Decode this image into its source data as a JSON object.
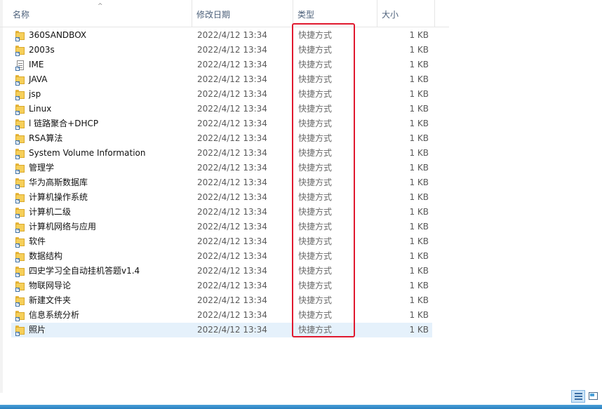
{
  "columns": {
    "name": "名称",
    "date": "修改日期",
    "type": "类型",
    "size": "大小"
  },
  "files": [
    {
      "name": "360SANDBOX",
      "date": "2022/4/12 13:34",
      "type": "快捷方式",
      "size": "1 KB",
      "icon": "folder-shortcut-icon"
    },
    {
      "name": "2003s",
      "date": "2022/4/12 13:34",
      "type": "快捷方式",
      "size": "1 KB",
      "icon": "folder-shortcut-icon"
    },
    {
      "name": "IME",
      "date": "2022/4/12 13:34",
      "type": "快捷方式",
      "size": "1 KB",
      "icon": "document-shortcut-icon"
    },
    {
      "name": "JAVA",
      "date": "2022/4/12 13:34",
      "type": "快捷方式",
      "size": "1 KB",
      "icon": "folder-shortcut-icon"
    },
    {
      "name": "jsp",
      "date": "2022/4/12 13:34",
      "type": "快捷方式",
      "size": "1 KB",
      "icon": "folder-shortcut-icon"
    },
    {
      "name": "Linux",
      "date": "2022/4/12 13:34",
      "type": "快捷方式",
      "size": "1 KB",
      "icon": "folder-shortcut-icon"
    },
    {
      "name": "l 链路聚合+DHCP",
      "date": "2022/4/12 13:34",
      "type": "快捷方式",
      "size": "1 KB",
      "icon": "folder-shortcut-icon"
    },
    {
      "name": "RSA算法",
      "date": "2022/4/12 13:34",
      "type": "快捷方式",
      "size": "1 KB",
      "icon": "folder-shortcut-icon"
    },
    {
      "name": "System Volume Information",
      "date": "2022/4/12 13:34",
      "type": "快捷方式",
      "size": "1 KB",
      "icon": "folder-shortcut-icon"
    },
    {
      "name": "管理学",
      "date": "2022/4/12 13:34",
      "type": "快捷方式",
      "size": "1 KB",
      "icon": "folder-shortcut-icon"
    },
    {
      "name": "华为高斯数据库",
      "date": "2022/4/12 13:34",
      "type": "快捷方式",
      "size": "1 KB",
      "icon": "folder-shortcut-icon"
    },
    {
      "name": "计算机操作系统",
      "date": "2022/4/12 13:34",
      "type": "快捷方式",
      "size": "1 KB",
      "icon": "folder-shortcut-icon"
    },
    {
      "name": "计算机二级",
      "date": "2022/4/12 13:34",
      "type": "快捷方式",
      "size": "1 KB",
      "icon": "folder-shortcut-icon"
    },
    {
      "name": "计算机网络与应用",
      "date": "2022/4/12 13:34",
      "type": "快捷方式",
      "size": "1 KB",
      "icon": "folder-shortcut-icon"
    },
    {
      "name": "软件",
      "date": "2022/4/12 13:34",
      "type": "快捷方式",
      "size": "1 KB",
      "icon": "folder-shortcut-icon"
    },
    {
      "name": "数据结构",
      "date": "2022/4/12 13:34",
      "type": "快捷方式",
      "size": "1 KB",
      "icon": "folder-shortcut-icon"
    },
    {
      "name": "四史学习全自动挂机答题v1.4",
      "date": "2022/4/12 13:34",
      "type": "快捷方式",
      "size": "1 KB",
      "icon": "folder-shortcut-icon"
    },
    {
      "name": "物联网导论",
      "date": "2022/4/12 13:34",
      "type": "快捷方式",
      "size": "1 KB",
      "icon": "folder-shortcut-icon"
    },
    {
      "name": "新建文件夹",
      "date": "2022/4/12 13:34",
      "type": "快捷方式",
      "size": "1 KB",
      "icon": "folder-shortcut-icon"
    },
    {
      "name": "信息系统分析",
      "date": "2022/4/12 13:34",
      "type": "快捷方式",
      "size": "1 KB",
      "icon": "folder-shortcut-icon"
    },
    {
      "name": "照片",
      "date": "2022/4/12 13:34",
      "type": "快捷方式",
      "size": "1 KB",
      "icon": "folder-shortcut-icon",
      "selected": true
    }
  ],
  "colors": {
    "highlight_border": "#e0192e",
    "selected_row": "#e5f1fb",
    "header_text": "#4c607a"
  },
  "view_buttons": [
    {
      "icon": "details-view-icon",
      "active": true
    },
    {
      "icon": "large-icons-view-icon",
      "active": false
    }
  ]
}
